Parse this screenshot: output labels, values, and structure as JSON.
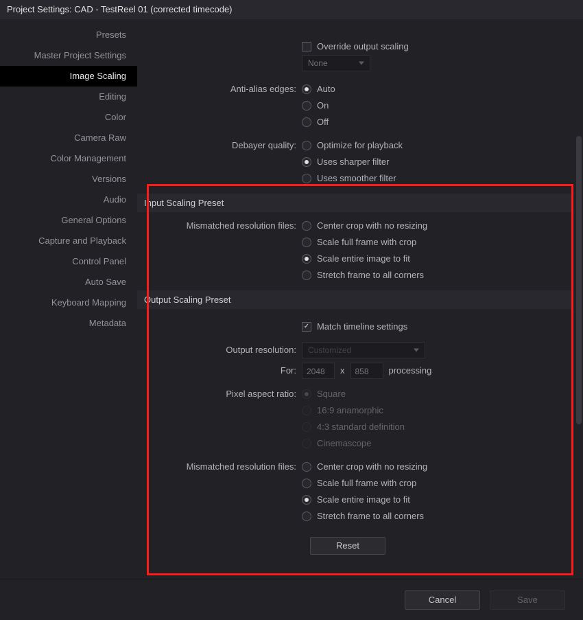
{
  "title": "Project Settings:  CAD - TestReel 01 (corrected timecode)",
  "sidebar": {
    "items": [
      {
        "label": "Presets"
      },
      {
        "label": "Master Project Settings"
      },
      {
        "label": "Image Scaling"
      },
      {
        "label": "Editing"
      },
      {
        "label": "Color"
      },
      {
        "label": "Camera Raw"
      },
      {
        "label": "Color Management"
      },
      {
        "label": "Versions"
      },
      {
        "label": "Audio"
      },
      {
        "label": "General Options"
      },
      {
        "label": "Capture and Playback"
      },
      {
        "label": "Control Panel"
      },
      {
        "label": "Auto Save"
      },
      {
        "label": "Keyboard Mapping"
      },
      {
        "label": "Metadata"
      }
    ],
    "active_index": 2
  },
  "top_controls": {
    "override_label": "Override output scaling",
    "none_select": "None",
    "antialias": {
      "label": "Anti-alias edges:",
      "options": [
        "Auto",
        "On",
        "Off"
      ],
      "selected": 0
    },
    "debayer": {
      "label": "Debayer quality:",
      "options": [
        "Optimize for playback",
        "Uses sharper filter",
        "Uses smoother filter"
      ],
      "selected": 1
    }
  },
  "input_preset": {
    "header": "Input Scaling Preset",
    "mismatch": {
      "label": "Mismatched resolution files:",
      "options": [
        "Center crop with no resizing",
        "Scale full frame with crop",
        "Scale entire image to fit",
        "Stretch frame to all corners"
      ],
      "selected": 2
    }
  },
  "output_preset": {
    "header": "Output Scaling Preset",
    "match_timeline": "Match timeline settings",
    "match_timeline_checked": true,
    "output_res": {
      "label": "Output resolution:",
      "value": "Customized"
    },
    "for": {
      "label": "For:",
      "w": "2048",
      "sep": "x",
      "h": "858",
      "suffix": "processing"
    },
    "pixel_ar": {
      "label": "Pixel aspect ratio:",
      "options": [
        "Square",
        "16:9 anamorphic",
        "4:3 standard definition",
        "Cinemascope"
      ],
      "selected": 0
    },
    "mismatch": {
      "label": "Mismatched resolution files:",
      "options": [
        "Center crop with no resizing",
        "Scale full frame with crop",
        "Scale entire image to fit",
        "Stretch frame to all corners"
      ],
      "selected": 2
    },
    "reset": "Reset"
  },
  "bottom": {
    "cancel": "Cancel",
    "save": "Save"
  }
}
